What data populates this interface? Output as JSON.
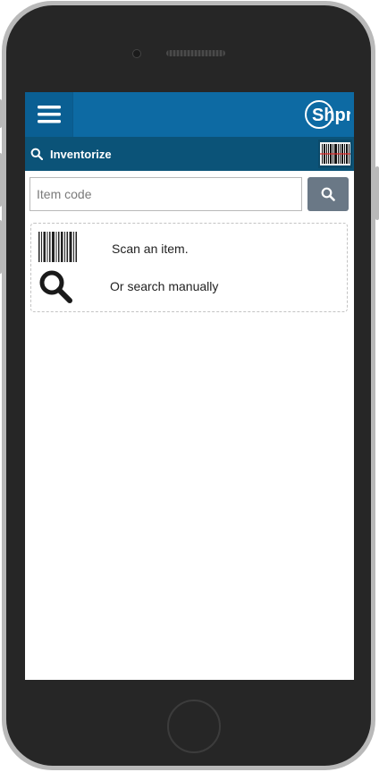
{
  "app": {
    "logo_text": "Shpr",
    "brand_color": "#0d6aa3",
    "subbar_color": "#0b5378"
  },
  "header": {
    "menu_icon": "hamburger-menu-icon"
  },
  "subheader": {
    "title": "Inventorize",
    "icon": "search-icon",
    "scan_icon": "barcode-scan-icon"
  },
  "search": {
    "placeholder": "Item code",
    "value": "",
    "button_icon": "search-icon"
  },
  "hints": {
    "scan_text": "Scan an item.",
    "scan_icon": "barcode-icon",
    "search_text": "Or search manually",
    "search_icon": "magnifier-icon"
  }
}
